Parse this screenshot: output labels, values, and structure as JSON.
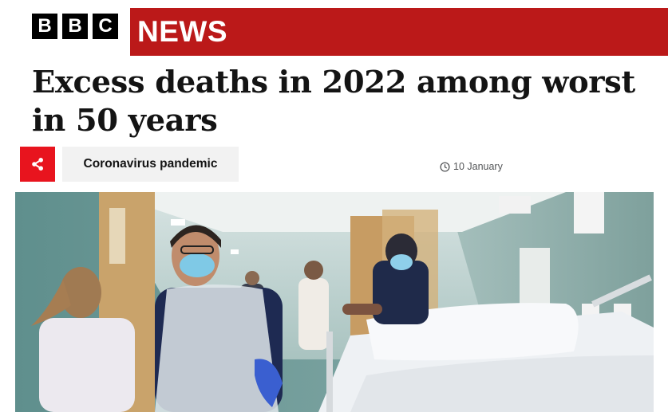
{
  "masthead": {
    "logo_letters": [
      "B",
      "B",
      "C"
    ],
    "section_label": "NEWS",
    "banner_color": "#bb1919"
  },
  "article": {
    "headline": "Excess deaths in 2022 among worst in 50 years",
    "topic_tag": "Coronavirus pandemic",
    "timestamp": "10 January",
    "share_icon": "share-icon",
    "clock_icon": "clock-icon",
    "share_color": "#e8141e"
  }
}
